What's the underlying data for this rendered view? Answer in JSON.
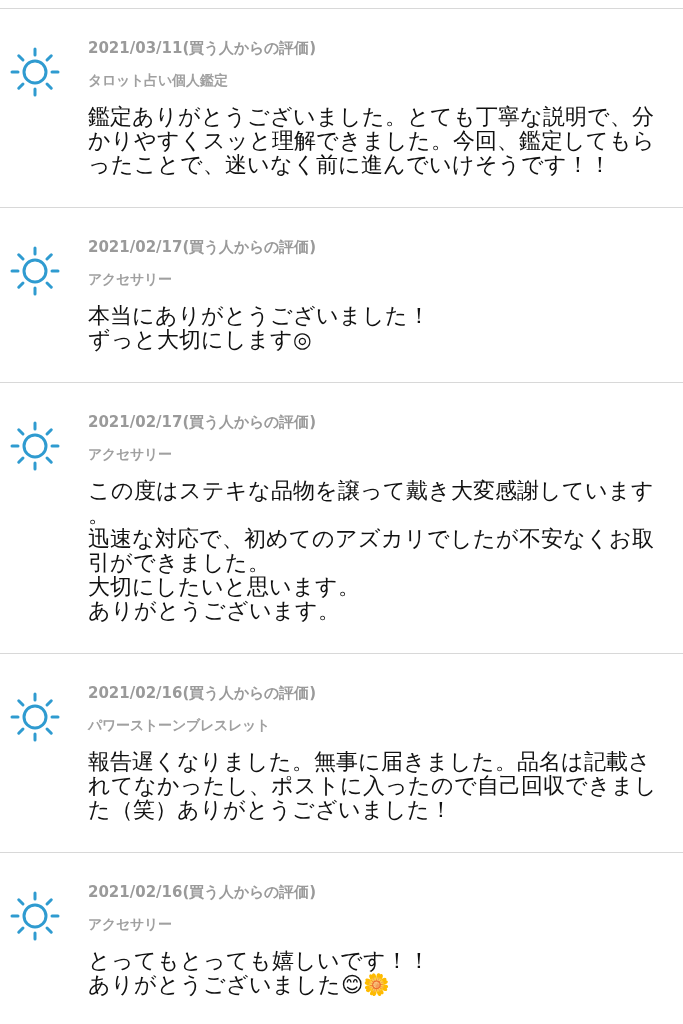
{
  "reviews": [
    {
      "kind": "sun",
      "date": "2021/03/11(買う人からの評価)",
      "item": "タロット占い個人鑑定",
      "lines": [
        "鑑定ありがとうございました。とても丁寧な説明で、分",
        "かりやすくスッと理解できました。今回、鑑定してもら",
        "ったことで、迷いなく前に進んでいけそうです！！"
      ]
    },
    {
      "kind": "sun",
      "date": "2021/02/17(買う人からの評価)",
      "item": "アクセサリー",
      "lines": [
        "本当にありがとうございました！",
        "ずっと大切にします◎"
      ]
    },
    {
      "kind": "sun",
      "date": "2021/02/17(買う人からの評価)",
      "item": "アクセサリー",
      "lines": [
        "この度はステキな品物を譲って戴き大変感謝しています",
        "。",
        "迅速な対応で、初めてのアズカリでしたが不安なくお取",
        "引ができました。",
        "大切にしたいと思います。",
        "ありがとうございます。"
      ]
    },
    {
      "kind": "sun",
      "date": "2021/02/16(買う人からの評価)",
      "item": "パワーストーンブレスレット",
      "lines": [
        "報告遅くなりました。無事に届きました。品名は記載さ",
        "れてなかったし、ポストに入ったので自己回収できまし",
        "た（笑）ありがとうございました！"
      ]
    },
    {
      "kind": "sun",
      "date": "2021/02/16(買う人からの評価)",
      "item": "アクセサリー",
      "lines": [
        "とってもとっても嬉しいです！！",
        "ありがとうございました😊🌼"
      ]
    }
  ]
}
